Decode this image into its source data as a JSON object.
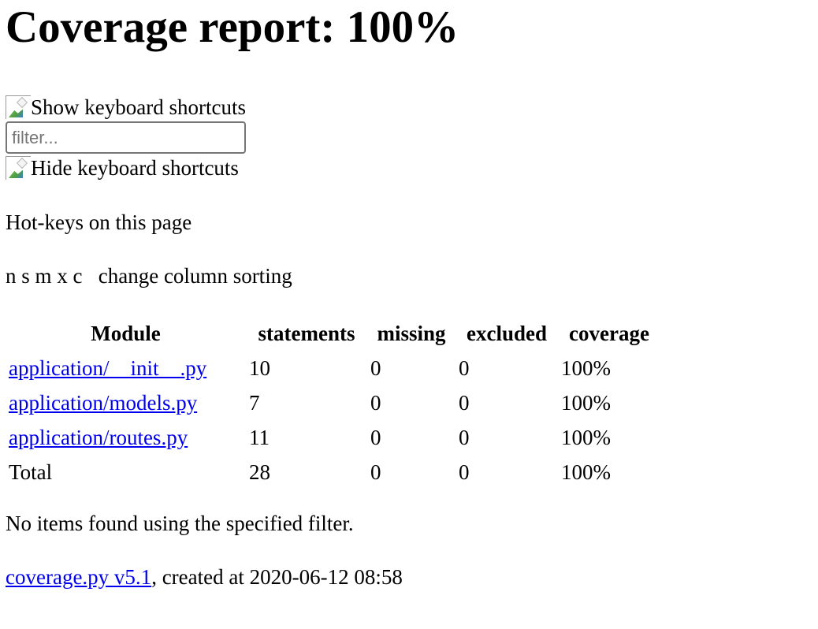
{
  "header": {
    "title": "Coverage report: 100%"
  },
  "shortcuts": {
    "show_label": "Show keyboard shortcuts",
    "hide_label": "Hide keyboard shortcuts"
  },
  "filter": {
    "placeholder": "filter...",
    "value": ""
  },
  "hotkeys": {
    "title": "Hot-keys on this page",
    "keys": "n s m x c",
    "description": "change column sorting"
  },
  "table": {
    "headers": {
      "module": "Module",
      "statements": "statements",
      "missing": "missing",
      "excluded": "excluded",
      "coverage": "coverage"
    },
    "rows": [
      {
        "module": "application/__init__.py",
        "statements": "10",
        "missing": "0",
        "excluded": "0",
        "coverage": "100%"
      },
      {
        "module": "application/models.py",
        "statements": "7",
        "missing": "0",
        "excluded": "0",
        "coverage": "100%"
      },
      {
        "module": "application/routes.py",
        "statements": "11",
        "missing": "0",
        "excluded": "0",
        "coverage": "100%"
      }
    ],
    "total": {
      "module": "Total",
      "statements": "28",
      "missing": "0",
      "excluded": "0",
      "coverage": "100%"
    }
  },
  "messages": {
    "no_items": "No items found using the specified filter."
  },
  "footer": {
    "link_text": "coverage.py v5.1",
    "created_text": ", created at 2020-06-12 08:58"
  },
  "icons": {
    "show_shortcuts": "broken-image-icon",
    "hide_shortcuts": "broken-image-icon"
  }
}
